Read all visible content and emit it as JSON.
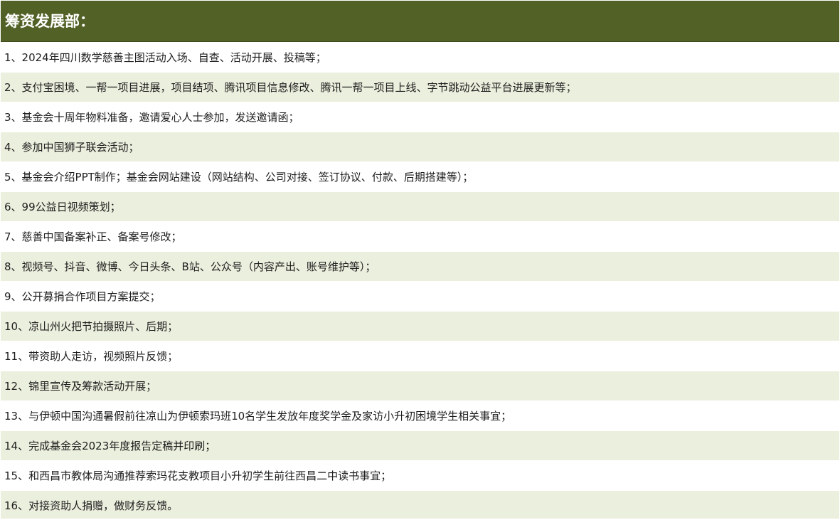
{
  "header": {
    "title": "筹资发展部："
  },
  "items": [
    "1、2024年四川数学慈善主图活动入场、自查、活动开展、投稿等；",
    "2、支付宝困境、一帮一项目进展，项目结项、腾讯项目信息修改、腾讯一帮一项目上线、字节跳动公益平台进展更新等；",
    "3、基金会十周年物料准备，邀请爱心人士参加，发送邀请函；",
    "4、参加中国狮子联会活动；",
    "5、基金会介绍PPT制作；基金会网站建设（网站结构、公司对接、签订协议、付款、后期搭建等）；",
    "6、99公益日视频策划；",
    "7、慈善中国备案补正、备案号修改；",
    "8、视频号、抖音、微博、今日头条、B站、公众号（内容产出、账号维护等）；",
    "9、公开募捐合作项目方案提交；",
    "10、凉山州火把节拍摄照片、后期；",
    "11、带资助人走访，视频照片反馈；",
    "12、锦里宣传及筹款活动开展；",
    "13、与伊顿中国沟通暑假前往凉山为伊顿索玛班10名学生发放年度奖学金及家访小升初困境学生相关事宜；",
    "14、完成基金会2023年度报告定稿并印刷；",
    "15、和西昌市教体局沟通推荐索玛花支教项目小升初学生前往西昌二中读书事宜；",
    "16、对接资助人捐赠，做财务反馈。"
  ]
}
